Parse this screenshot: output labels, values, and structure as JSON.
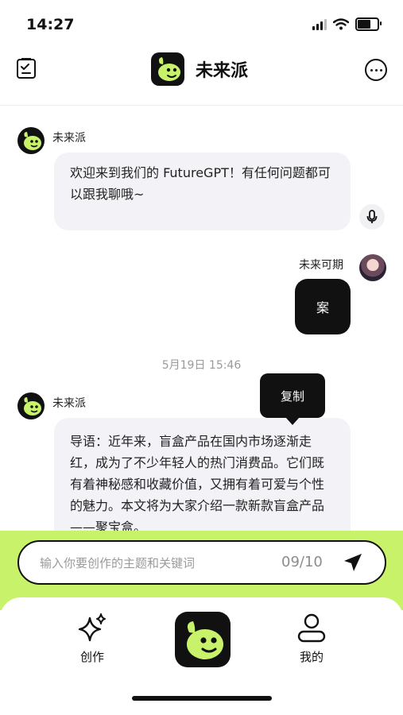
{
  "status_bar": {
    "time": "14:27"
  },
  "nav": {
    "title": "未来派",
    "left_icon": "clipboard-check-icon",
    "right_icon": "more-icon"
  },
  "messages": [
    {
      "role": "bot",
      "sender": "未来派",
      "text": "欢迎来到我们的 FutureGPT！有任何问题都可以跟我聊哦~"
    },
    {
      "role": "user",
      "sender": "未来可期",
      "text": "案"
    },
    {
      "role": "time",
      "text": "5月19日 15:46"
    },
    {
      "role": "bot",
      "sender": "未来派",
      "text": "导语：近年来，盲盒产品在国内市场逐渐走红，成为了不少年轻人的热门消费品。它们既有着神秘感和收藏价值，又拥有着可爱与个性的魅力。本文将为大家介绍一款新款盲盒产品——聚宝盒。"
    }
  ],
  "tooltip": {
    "label": "复制"
  },
  "input": {
    "placeholder": "输入你要创作的主题和关键词",
    "counter": "09/10"
  },
  "tabbar": {
    "create_label": "创作",
    "mine_label": "我的"
  },
  "colors": {
    "accent": "#c9f26b",
    "dark": "#111111",
    "bubble": "#f3f3f7"
  }
}
